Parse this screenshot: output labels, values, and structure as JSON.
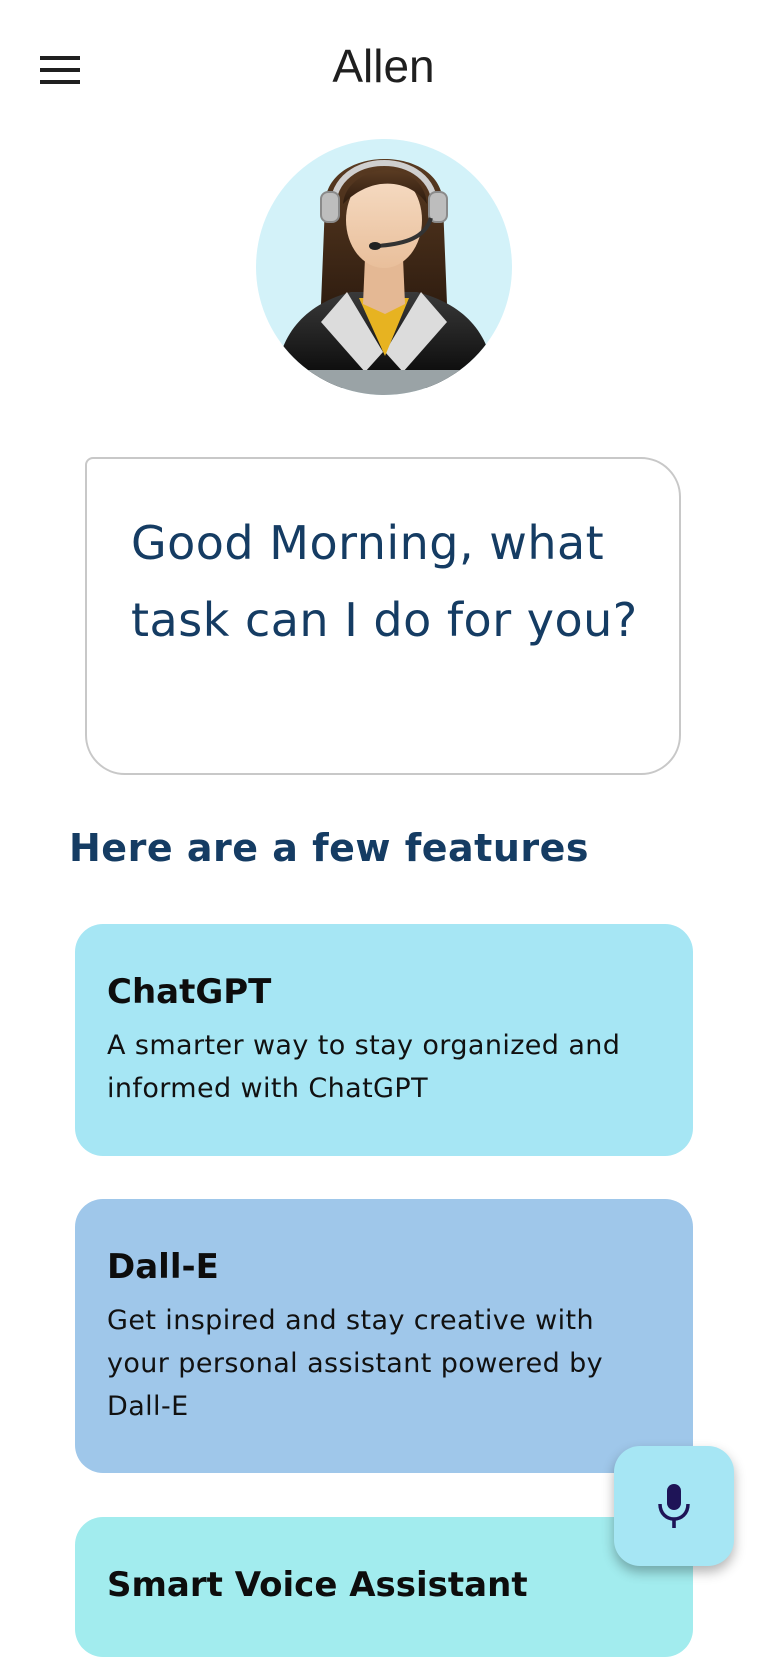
{
  "appbar": {
    "title": "Allen",
    "menu_icon": "menu-icon"
  },
  "avatar": {
    "icon": "assistant-avatar",
    "circle_color": "#d3f2f9"
  },
  "greeting": {
    "text": "Good Morning, what task can I do for you?"
  },
  "features": {
    "heading": "Here are a few features",
    "cards": [
      {
        "title": "ChatGPT",
        "description": "A smarter way to stay organized and informed with ChatGPT",
        "color": "#a6e6f4"
      },
      {
        "title": "Dall-E",
        "description": "Get inspired and stay creative with your personal assistant powered by Dall-E",
        "color": "#9fc7ea"
      },
      {
        "title": "Smart Voice Assistant",
        "description": "",
        "color": "#a2ecee"
      }
    ]
  },
  "fab": {
    "icon": "microphone-icon",
    "color": "#a6e6f4",
    "icon_color": "#1e1457"
  },
  "colors": {
    "primary_text": "#153c63",
    "border": "#c8c8c8"
  }
}
